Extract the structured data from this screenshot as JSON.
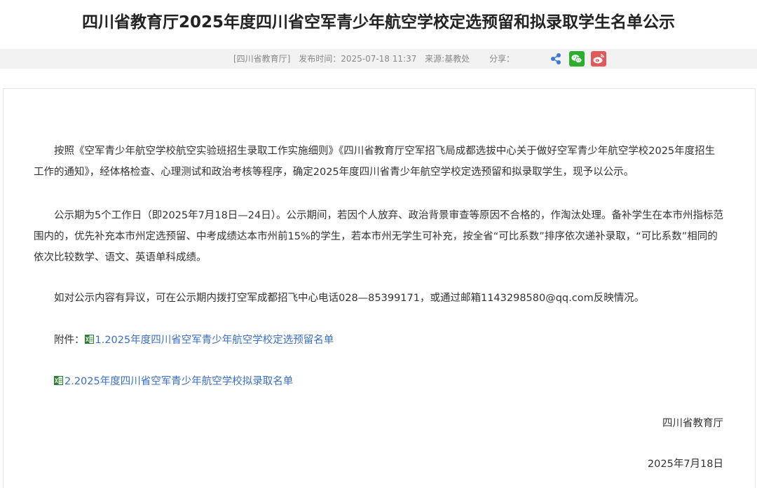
{
  "article": {
    "title": "四川省教育厅2025年度四川省空军青少年航空学校定选预留和拟录取学生名单公示"
  },
  "meta": {
    "source": "[四川省教育厅]",
    "published": "发布时间：2025-07-18 11:37",
    "department": "来源:基教处",
    "share_label": "分享："
  },
  "share": {
    "icons": [
      "share-icon",
      "wechat-icon",
      "weibo-icon"
    ],
    "colors": {
      "share": "#3a7bd5",
      "wechat": "#2aae2c",
      "weibo": "#e05a5a"
    }
  },
  "body": {
    "p1": "按照《空军青少年航空学校航空实验班招生录取工作实施细则》《四川省教育厅空军招飞局成都选拔中心关于做好空军青少年航空学校2025年度招生工作的通知》，经体格检查、心理测试和政治考核等程序，确定2025年度四川省青少年航空学校定选预留和拟录取学生，现予以公示。",
    "p2": "公示期为5个工作日（即2025年7月18日—24日）。公示期间，若因个人放弃、政治背景审查等原因不合格的，作淘汰处理。备补学生在本市州指标范围内的，优先补充本市州定选预留、中考成绩达本市州前15%的学生，若本市州无学生可补充，按全省“可比系数”排序依次递补录取，“可比系数”相同的依次比较数学、语文、英语单科成绩。",
    "p3": "如对公示内容有异议，可在公示期内拨打空军成都招飞中心电话028—85399171，或通过邮箱1143298580@qq.com反映情况。"
  },
  "attachments": {
    "label": "附件：",
    "items": [
      "1.2025年度四川省空军青少年航空学校定选预留名单",
      "2.2025年度四川省空军青少年航空学校拟录取名单"
    ]
  },
  "signature": {
    "org": "四川省教育厅",
    "date": "2025年7月18日"
  }
}
